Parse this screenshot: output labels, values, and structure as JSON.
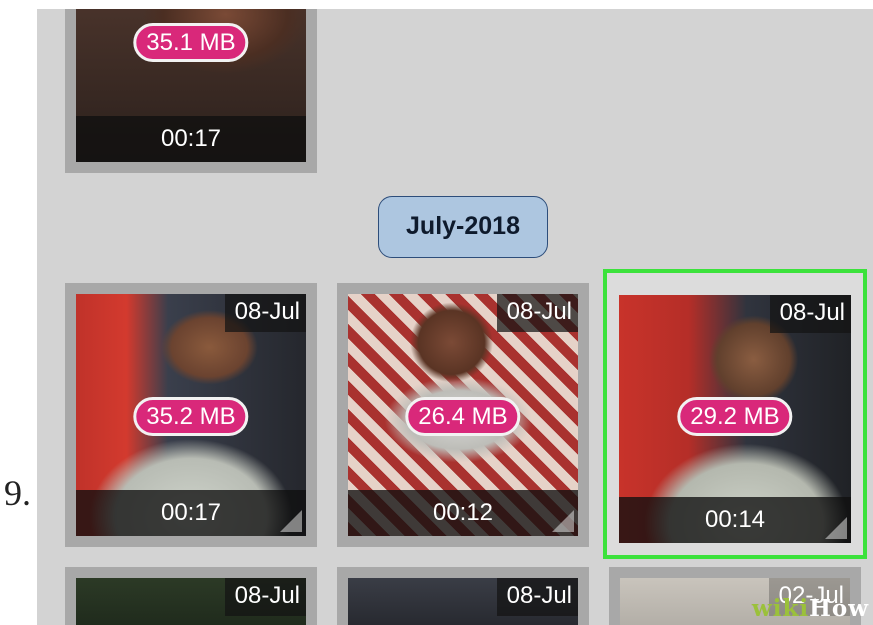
{
  "step_number": "9.",
  "month_header": "July-2018",
  "top_video": {
    "size": "35.1 MB",
    "duration": "00:17"
  },
  "videos": [
    {
      "date": "08-Jul",
      "size": "35.2 MB",
      "duration": "00:17",
      "selected": false
    },
    {
      "date": "08-Jul",
      "size": "26.4 MB",
      "duration": "00:12",
      "selected": false
    },
    {
      "date": "08-Jul",
      "size": "29.2 MB",
      "duration": "00:14",
      "selected": true
    }
  ],
  "partial_videos": [
    {
      "date": "08-Jul"
    },
    {
      "date": "08-Jul"
    },
    {
      "date": "02-Jul"
    }
  ],
  "watermark": {
    "wiki": "wiki",
    "how": "How"
  },
  "colors": {
    "size_badge": "#d9287a",
    "selection_border": "#3ce23c",
    "month_header_bg": "#adc6e0",
    "screen_bg": "#d3d3d3"
  }
}
